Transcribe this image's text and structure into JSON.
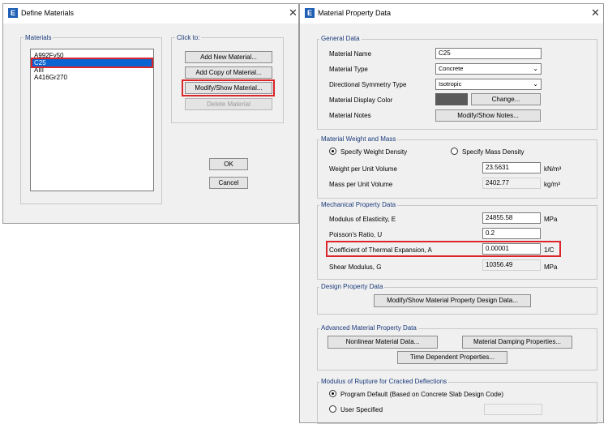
{
  "define_materials": {
    "title": "Define Materials",
    "materials_label": "Materials",
    "click_to_label": "Click to:",
    "materials": [
      "A992Fy50",
      "C25",
      "AIII",
      "A416Gr270"
    ],
    "selected_index": 1,
    "buttons": {
      "add_new": "Add New Material...",
      "add_copy": "Add Copy of Material...",
      "modify_show": "Modify/Show Material...",
      "delete": "Delete Material",
      "ok": "OK",
      "cancel": "Cancel"
    }
  },
  "material_property": {
    "title": "Material Property Data",
    "general": {
      "label": "General Data",
      "name_label": "Material Name",
      "name_value": "C25",
      "type_label": "Material Type",
      "type_value": "Concrete",
      "symmetry_label": "Directional Symmetry Type",
      "symmetry_value": "Isotropic",
      "color_label": "Material Display Color",
      "change_button": "Change...",
      "notes_label": "Material Notes",
      "notes_button": "Modify/Show Notes..."
    },
    "weight": {
      "label": "Material Weight and Mass",
      "specify_weight": "Specify Weight Density",
      "specify_mass": "Specify Mass Density",
      "weight_label": "Weight per Unit Volume",
      "weight_value": "23.5631",
      "weight_unit": "kN/m³",
      "mass_label": "Mass per Unit Volume",
      "mass_value": "2402.77",
      "mass_unit": "kg/m³"
    },
    "mechanical": {
      "label": "Mechanical Property Data",
      "modulus_label": "Modulus of Elasticity,  E",
      "modulus_value": "24855.58",
      "modulus_unit": "MPa",
      "poisson_label": "Poisson's Ratio,  U",
      "poisson_value": "0.2",
      "thermal_label": "Coefficient of Thermal Expansion,  A",
      "thermal_value": "0.00001",
      "thermal_unit": "1/C",
      "shear_label": "Shear Modulus,  G",
      "shear_value": "10356.49",
      "shear_unit": "MPa"
    },
    "design": {
      "label": "Design Property Data",
      "button": "Modify/Show Material Property Design Data..."
    },
    "advanced": {
      "label": "Advanced Material Property Data",
      "nonlinear_button": "Nonlinear Material Data...",
      "damping_button": "Material Damping Properties...",
      "time_button": "Time Dependent Properties..."
    },
    "rupture": {
      "label": "Modulus of Rupture for Cracked Deflections",
      "program_default": "Program Default  (Based on Concrete Slab Design Code)",
      "user_specified": "User Specified"
    }
  },
  "colors": {
    "selection": "#0a64d2",
    "highlight": "#d9252b",
    "display_color_swatch": "#5a5a5a",
    "icon": "#1f5fb4"
  },
  "icons": [
    "etabs-app-icon",
    "close-icon",
    "chevron-down-icon"
  ]
}
